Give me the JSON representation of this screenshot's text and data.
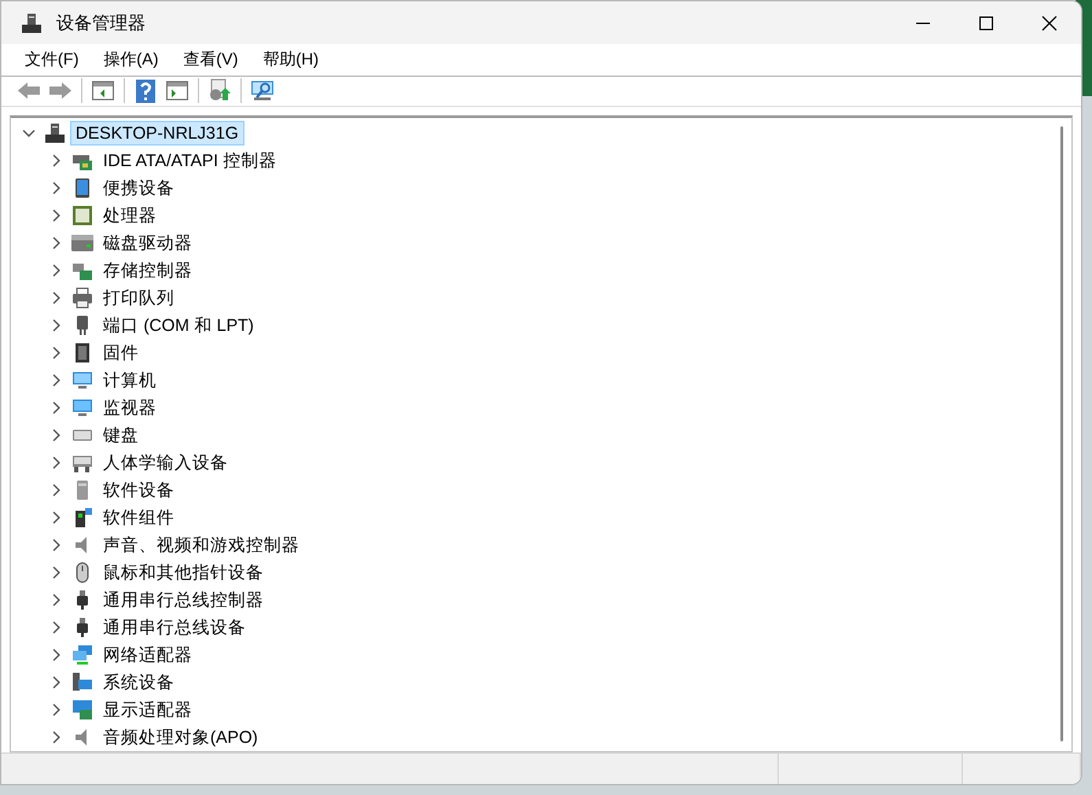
{
  "window": {
    "title": "设备管理器"
  },
  "menu": [
    "文件(F)",
    "操作(A)",
    "查看(V)",
    "帮助(H)"
  ],
  "toolbar": [
    {
      "kind": "back",
      "disabled": true
    },
    {
      "kind": "forward",
      "disabled": true
    },
    {
      "kind": "separator"
    },
    {
      "kind": "console-tree",
      "disabled": false
    },
    {
      "kind": "separator"
    },
    {
      "kind": "help",
      "disabled": false
    },
    {
      "kind": "action-pane",
      "disabled": false
    },
    {
      "kind": "separator"
    },
    {
      "kind": "update-driver",
      "disabled": false
    },
    {
      "kind": "separator"
    },
    {
      "kind": "scan",
      "disabled": false
    }
  ],
  "tree": {
    "label": "DESKTOP-NRLJ31G",
    "expanded": true,
    "selected": true,
    "children": [
      {
        "label": "IDE ATA/ATAPI 控制器",
        "expanded": false,
        "selected": false
      },
      {
        "label": "便携设备",
        "expanded": false,
        "selected": false
      },
      {
        "label": "处理器",
        "expanded": false,
        "selected": false
      },
      {
        "label": "磁盘驱动器",
        "expanded": false,
        "selected": false
      },
      {
        "label": "存储控制器",
        "expanded": false,
        "selected": false
      },
      {
        "label": "打印队列",
        "expanded": false,
        "selected": false
      },
      {
        "label": "端口 (COM 和 LPT)",
        "expanded": false,
        "selected": false
      },
      {
        "label": "固件",
        "expanded": false,
        "selected": false
      },
      {
        "label": "计算机",
        "expanded": false,
        "selected": false
      },
      {
        "label": "监视器",
        "expanded": false,
        "selected": false
      },
      {
        "label": "键盘",
        "expanded": false,
        "selected": false
      },
      {
        "label": "人体学输入设备",
        "expanded": false,
        "selected": false
      },
      {
        "label": "软件设备",
        "expanded": false,
        "selected": false
      },
      {
        "label": "软件组件",
        "expanded": false,
        "selected": false
      },
      {
        "label": "声音、视频和游戏控制器",
        "expanded": false,
        "selected": false
      },
      {
        "label": "鼠标和其他指针设备",
        "expanded": false,
        "selected": false
      },
      {
        "label": "通用串行总线控制器",
        "expanded": false,
        "selected": false
      },
      {
        "label": "通用串行总线设备",
        "expanded": false,
        "selected": false
      },
      {
        "label": "网络适配器",
        "expanded": false,
        "selected": false
      },
      {
        "label": "系统设备",
        "expanded": false,
        "selected": false
      },
      {
        "label": "显示适配器",
        "expanded": false,
        "selected": false
      },
      {
        "label": "音频处理对象(APO)",
        "expanded": false,
        "selected": false
      }
    ]
  }
}
